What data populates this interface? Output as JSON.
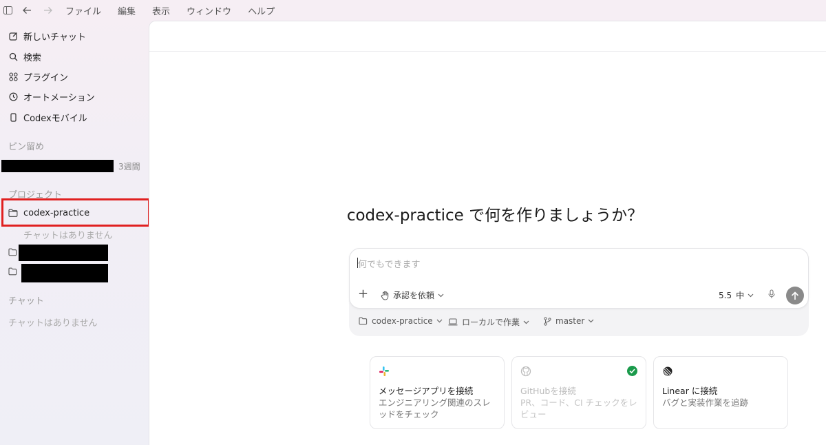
{
  "menubar": {
    "items": [
      "ファイル",
      "編集",
      "表示",
      "ウィンドウ",
      "ヘルプ"
    ]
  },
  "sidebar": {
    "nav": [
      {
        "label": "新しいチャット",
        "icon": "edit-icon"
      },
      {
        "label": "検索",
        "icon": "search-icon"
      },
      {
        "label": "プラグイン",
        "icon": "plugin-grid-icon"
      },
      {
        "label": "オートメーション",
        "icon": "clock-icon"
      },
      {
        "label": "Codexモバイル",
        "icon": "phone-icon"
      }
    ],
    "pinned_heading": "ピン留め",
    "pinned_item_time": "3週間",
    "projects_heading": "プロジェクト",
    "project_name": "codex-practice",
    "project_empty": "チャットはありません",
    "chats_heading": "チャット",
    "chats_empty": "チャットはありません"
  },
  "main": {
    "headline": "codex-practice で何を作りましょうか？",
    "composer": {
      "placeholder": "何でもできます",
      "approval_label": "承認を依頼",
      "model_version": "5.5",
      "model_effort": "中"
    },
    "context": {
      "project": "codex-practice",
      "location": "ローカルで作業",
      "branch": "master"
    },
    "cards": [
      {
        "title": "メッセージアプリを接続",
        "desc": "エンジニアリング関連のスレッドをチェック",
        "icon": "slack-icon"
      },
      {
        "title": "GitHubを接続",
        "desc": "PR、コード、CI チェックをレビュー",
        "icon": "github-icon"
      },
      {
        "title": "Linear に接続",
        "desc": "バグと実装作業を追跡",
        "icon": "linear-icon"
      }
    ]
  },
  "colors": {
    "highlight": "#e02020",
    "connected": "#1a9a4b"
  }
}
